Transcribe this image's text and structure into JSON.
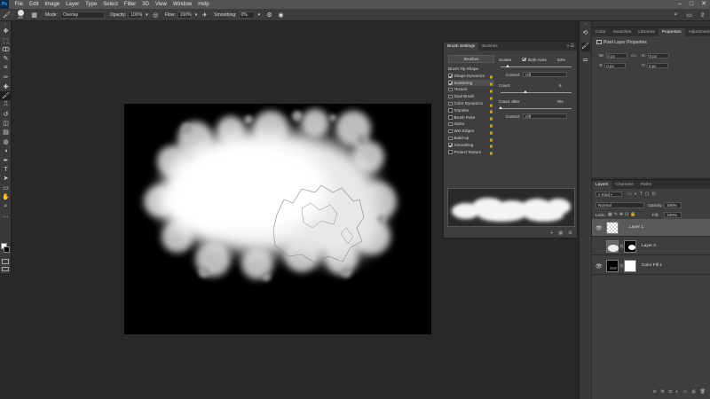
{
  "menu": {
    "logo": "Ps",
    "items": [
      "File",
      "Edit",
      "Image",
      "Layer",
      "Type",
      "Select",
      "Filter",
      "3D",
      "View",
      "Window",
      "Help"
    ],
    "window_controls": [
      "–",
      "□",
      "✕"
    ]
  },
  "options_bar": {
    "brush_size": "300",
    "mode_label": "Mode:",
    "mode_value": "Overlay",
    "opacity_label": "Opacity:",
    "opacity_value": "100%",
    "flow_label": "Flow:",
    "flow_value": "100%",
    "smoothing_label": "Smoothing:",
    "smoothing_value": "0%"
  },
  "tools": {
    "icons": [
      "move-icon",
      "marquee-icon",
      "lasso-icon",
      "quick-select-icon",
      "crop-icon",
      "eyedropper-icon",
      "healing-icon",
      "brush-icon",
      "stamp-icon",
      "history-brush-icon",
      "eraser-icon",
      "gradient-icon",
      "blur-icon",
      "dodge-icon",
      "pen-icon",
      "type-icon",
      "path-select-icon",
      "shape-icon",
      "hand-icon",
      "zoom-icon",
      "more-icon"
    ],
    "glyphs": [
      "✥",
      "⬚",
      "ↀ",
      "✎",
      "⌗",
      "✑",
      "✚",
      "🖌",
      "⎍",
      "↺",
      "◫",
      "▤",
      "◍",
      "◑",
      "✒",
      "T",
      "➤",
      "▭",
      "✋",
      "⌕",
      "…"
    ]
  },
  "brush_settings": {
    "tabs": [
      "Brush Settings",
      "Brushes"
    ],
    "brushes_button": "Brushes",
    "items": [
      {
        "label": "Brush Tip Shape",
        "checkbox": false,
        "checked": false,
        "lock": false
      },
      {
        "label": "Shape Dynamics",
        "checkbox": true,
        "checked": true,
        "lock": true
      },
      {
        "label": "Scattering",
        "checkbox": true,
        "checked": true,
        "lock": true,
        "selected": true
      },
      {
        "label": "Texture",
        "checkbox": true,
        "checked": false,
        "lock": true
      },
      {
        "label": "Dual Brush",
        "checkbox": true,
        "checked": false,
        "lock": true
      },
      {
        "label": "Color Dynamics",
        "checkbox": true,
        "checked": false,
        "lock": true
      },
      {
        "label": "Transfer",
        "checkbox": true,
        "checked": false,
        "lock": true
      },
      {
        "label": "Brush Pose",
        "checkbox": true,
        "checked": false,
        "lock": true
      },
      {
        "label": "Noise",
        "checkbox": true,
        "checked": false,
        "lock": true
      },
      {
        "label": "Wet Edges",
        "checkbox": true,
        "checked": false,
        "lock": true
      },
      {
        "label": "Build-up",
        "checkbox": true,
        "checked": false,
        "lock": true
      },
      {
        "label": "Smoothing",
        "checkbox": true,
        "checked": true,
        "lock": true
      },
      {
        "label": "Protect Texture",
        "checkbox": true,
        "checked": false,
        "lock": true
      }
    ],
    "scatter_label": "Scatter",
    "both_axes_label": "Both Axes",
    "scatter_value": "53%",
    "scatter_fraction": 0.1,
    "control_label": "Control:",
    "control_value": "Off",
    "count_label": "Count",
    "count_value": "6",
    "count_fraction": 0.35,
    "count_jitter_label": "Count Jitter",
    "count_jitter_value": "0%",
    "count_jitter_fraction": 0.0,
    "control2_label": "Control:",
    "control2_value": "Off"
  },
  "properties": {
    "tabs": [
      "Color",
      "Swatches",
      "Libraries",
      "Properties",
      "Adjustments"
    ],
    "heading": "Pixel Layer Properties",
    "w_label": "W:",
    "w_value": "0 px",
    "h_label": "H:",
    "h_value": "0 px",
    "x_label": "X:",
    "x_value": "0 px",
    "y_label": "Y:",
    "y_value": "0 px",
    "link_icon": "GO"
  },
  "layers": {
    "tabs": [
      "Layers",
      "Channels",
      "Paths"
    ],
    "filter_kind": "Kind",
    "blend_mode": "Normal",
    "opacity_label": "Opacity:",
    "opacity_value": "100%",
    "lock_label": "Lock:",
    "fill_label": "Fill:",
    "fill_value": "100%",
    "items": [
      {
        "name": "Layer 1",
        "selected": true
      },
      {
        "name": "Layer 0",
        "selected": false
      },
      {
        "name": "Color Fill 1",
        "selected": false
      }
    ],
    "footer_icons": [
      "link-icon",
      "fx-icon",
      "mask-icon",
      "adjustment-icon",
      "group-icon",
      "new-layer-icon",
      "trash-icon"
    ],
    "footer_glyphs": [
      "⊝",
      "fx",
      "◘",
      "◐",
      "▭",
      "⊞",
      "🗑"
    ]
  },
  "colors": {
    "ps_blue": "#31a8ff",
    "selected_layer": "#595959"
  }
}
